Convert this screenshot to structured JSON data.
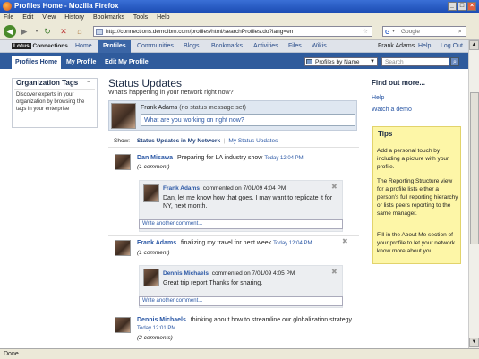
{
  "window": {
    "title": "Profiles Home - Mozilla Firefox",
    "controls": [
      "_",
      "□",
      "×"
    ]
  },
  "menu": [
    "File",
    "Edit",
    "View",
    "History",
    "Bookmarks",
    "Tools",
    "Help"
  ],
  "toolbar": {
    "url": "http://connections.demoibm.com/profiles/html/searchProfiles.do?lang=en",
    "search_placeholder": "Google"
  },
  "app": {
    "logo_lotus": "Lotus",
    "logo_text": "Connections",
    "nav": [
      "Home",
      "Profiles",
      "Communities",
      "Blogs",
      "Bookmarks",
      "Activities",
      "Files",
      "Wikis"
    ],
    "user": "Frank Adams",
    "help": "Help",
    "logout": "Log Out"
  },
  "subnav": {
    "tabs": [
      "Profiles Home",
      "My Profile",
      "Edit My Profile"
    ],
    "filter": "Profiles by Name",
    "search_placeholder": "Search"
  },
  "sidebar": {
    "title": "Organization Tags",
    "collapse": "−",
    "description": "Discover experts in your organization by browsing the tags in your enterprise"
  },
  "main": {
    "title": "Status Updates",
    "subtitle": "What's happening in your network right now?",
    "poster_name": "Frank Adams",
    "poster_status": "(no status message set)",
    "post_placeholder": "What are you working on right now?",
    "show_label": "Show:",
    "show_options": [
      "Status Updates in My Network",
      "My Status Updates"
    ],
    "updates": [
      {
        "author": "Dan Misawa",
        "text": "Preparing for LA industry show",
        "time": "Today 12:04 PM",
        "comments_count": "(1 comment)",
        "comment": {
          "author": "Frank Adams",
          "meta": "commented on 7/01/09 4:04 PM",
          "text": "Dan, let me know how that goes. I may want to replicate it for NY, next month."
        },
        "write_comment": "Write another comment..."
      },
      {
        "author": "Frank Adams",
        "text": "finalizing my travel for next week",
        "time": "Today 12:04 PM",
        "comments_count": "(1 comment)",
        "comment": {
          "author": "Dennis Michaels",
          "meta": "commented on 7/01/09 4:05 PM",
          "text": "Great trip report Thanks for sharing."
        },
        "write_comment": "Write another comment..."
      },
      {
        "author": "Dennis Michaels",
        "text": "thinking about how to streamline our globalization strategy...",
        "time": "Today 12:01 PM",
        "comments_count": "(2 comments)"
      }
    ]
  },
  "right": {
    "find_more": "Find out more...",
    "help_link": "Help",
    "demo_link": "Watch a demo",
    "tips_title": "Tips",
    "tips": [
      "Add a personal touch by including a picture with your profile.",
      "The Reporting Structure view for a profile lists either a person's full reporting hierarchy or lists peers reporting to the same manager.",
      "Fill in the About Me section of your profile to let your network know more about you."
    ]
  },
  "statusbar": {
    "text": "Done"
  }
}
